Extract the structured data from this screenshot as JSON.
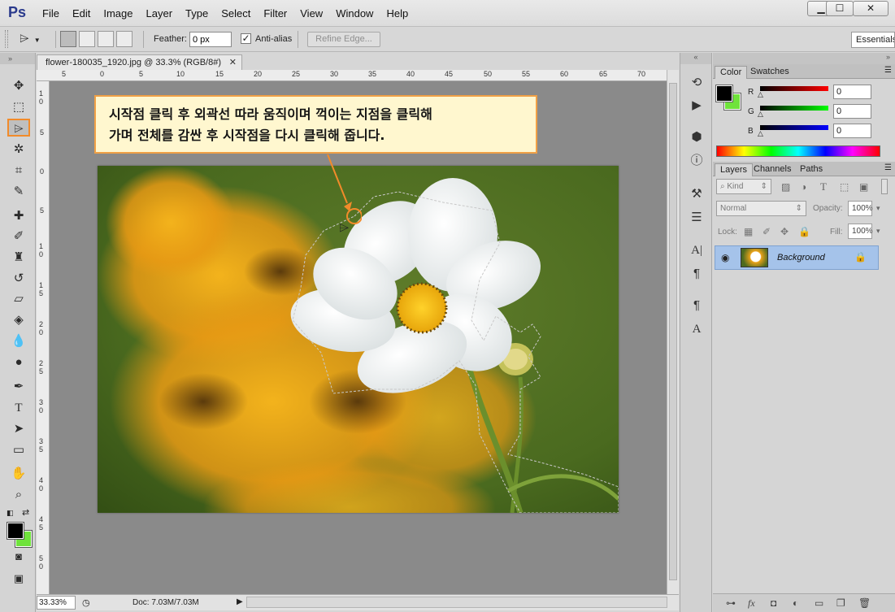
{
  "app": {
    "logo": "Ps",
    "menu": [
      "File",
      "Edit",
      "Image",
      "Layer",
      "Type",
      "Select",
      "Filter",
      "View",
      "Window",
      "Help"
    ],
    "window_controls": [
      "minimize",
      "maximize",
      "close"
    ]
  },
  "options": {
    "feather_label": "Feather:",
    "feather_value": "0 px",
    "antialias_label": "Anti-alias",
    "antialias_checked": true,
    "refine_edge_label": "Refine Edge...",
    "workspace": "Essentials"
  },
  "document": {
    "tab_title": "flower-180035_1920.jpg @ 33.3% (RGB/8#)",
    "ruler_top_labels": [
      "5",
      "0",
      "5",
      "10",
      "15",
      "20",
      "25",
      "30",
      "35",
      "40",
      "45",
      "50",
      "55",
      "60",
      "65",
      "70"
    ],
    "ruler_left_labels": [
      "1 0",
      "5",
      "0",
      "5",
      "1 0",
      "1 5",
      "2 0",
      "2 5",
      "3 0",
      "3 5",
      "4 0",
      "4 5",
      "5 0"
    ],
    "callout_line1": "시작점 클릭 후 외곽선 따라 움직이며 꺽이는 지점을 클릭해",
    "callout_line2": "가며 전체를 감싼 후 시작점을 다시 클릭해 줍니다.",
    "zoom": "33.33%",
    "doc_size": "Doc: 7.03M/7.03M"
  },
  "tools": {
    "active": "polygonal-lasso-tool",
    "foreground_color": "#000000",
    "background_color": "#6fe33b"
  },
  "color_panel": {
    "tabs": [
      "Color",
      "Swatches"
    ],
    "active_tab": "Color",
    "r_label": "R",
    "r_value": "0",
    "g_label": "G",
    "g_value": "0",
    "b_label": "B",
    "b_value": "0"
  },
  "layers_panel": {
    "tabs": [
      "Layers",
      "Channels",
      "Paths"
    ],
    "active_tab": "Layers",
    "kind_label": "Kind",
    "blend_mode": "Normal",
    "opacity_label": "Opacity:",
    "opacity_value": "100%",
    "lock_label": "Lock:",
    "fill_label": "Fill:",
    "fill_value": "100%",
    "layers": [
      {
        "name": "Background",
        "visible": true,
        "locked": true
      }
    ],
    "footer_icons": [
      "link-icon",
      "fx-icon",
      "mask-icon",
      "adjustment-icon",
      "group-icon",
      "new-layer-icon",
      "trash-icon"
    ]
  },
  "colors": {
    "accent_orange": "#f28b2a",
    "callout_bg": "#fff7cf",
    "layer_selected": "#a5c3ea"
  }
}
